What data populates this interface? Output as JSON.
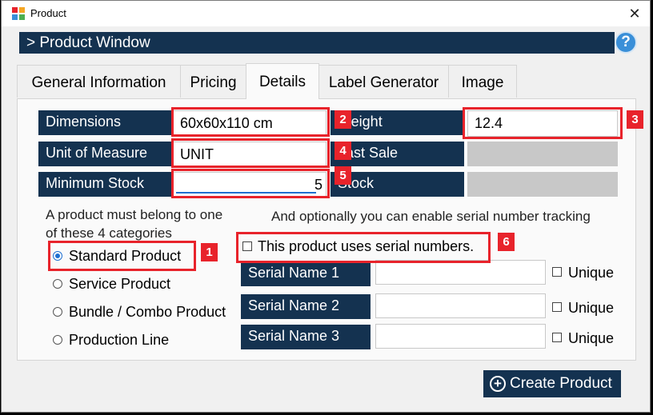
{
  "window": {
    "title": "Product",
    "close_label": "✕"
  },
  "header": {
    "title": "> Product Window",
    "help_label": "?"
  },
  "tabs": [
    {
      "label": "General Information"
    },
    {
      "label": "Pricing"
    },
    {
      "label": "Details",
      "active": true
    },
    {
      "label": "Label Generator"
    },
    {
      "label": "Image"
    }
  ],
  "details": {
    "dimensions": {
      "label": "Dimensions",
      "value": "60x60x110 cm"
    },
    "weight": {
      "label": "Weight",
      "value": "12.4"
    },
    "unit_of_measure": {
      "label": "Unit of Measure",
      "value": "UNIT"
    },
    "last_sale": {
      "label": "Last Sale",
      "value": ""
    },
    "minimum_stock": {
      "label": "Minimum Stock",
      "value": "5"
    },
    "stock": {
      "label": "Stock",
      "value": ""
    }
  },
  "categories": {
    "hint": "A product must belong to one of these 4 categories",
    "options": [
      {
        "label": "Standard Product",
        "selected": true
      },
      {
        "label": "Service Product",
        "selected": false
      },
      {
        "label": "Bundle / Combo Product",
        "selected": false
      },
      {
        "label": "Production Line",
        "selected": false
      }
    ]
  },
  "serial": {
    "hint": "And optionally you can enable serial number tracking",
    "checkbox_label": "This product uses serial numbers.",
    "checked": false,
    "rows": [
      {
        "label": "Serial Name 1",
        "value": "",
        "unique_label": "Unique"
      },
      {
        "label": "Serial Name 2",
        "value": "",
        "unique_label": "Unique"
      },
      {
        "label": "Serial Name 3",
        "value": "",
        "unique_label": "Unique"
      }
    ]
  },
  "annotations": [
    "1",
    "2",
    "3",
    "4",
    "5",
    "6"
  ],
  "footer": {
    "create_label": "Create Product"
  },
  "colors": {
    "navy": "#143250",
    "annotation_red": "#e8232b",
    "accent_blue": "#1f6fd0"
  }
}
